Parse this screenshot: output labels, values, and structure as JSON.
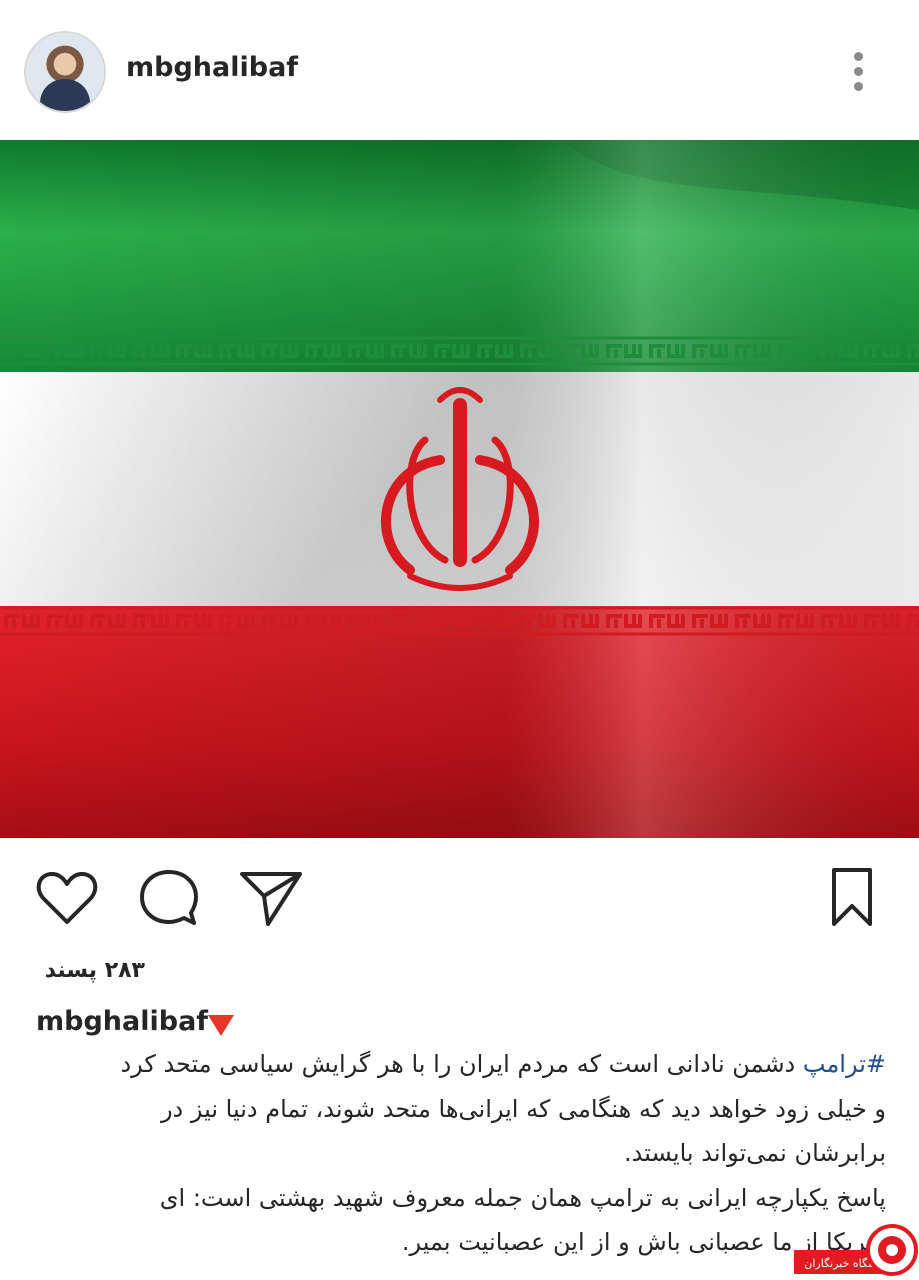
{
  "post": {
    "username": "mbghalibaf",
    "likes_label": "۲۸۳ پسند",
    "caption_username": "mbghalibaf",
    "hashtag": "#ترامپ",
    "caption_lines": [
      " دشمن نادانی است که مردم ایران را با هر گرایش سیاسی متحد کرد",
      "و خیلی زود خواهد دید که هنگامی که ایرانی‌ها متحد شوند، تمام دنیا نیز در",
      "برابرشان نمی‌تواند بایستد.",
      "پاسخ یکپارچه ایرانی به ترامپ همان جمله معروف شهید بهشتی است: ای",
      "آمریکا از ما عصبانی باش و از این عصبانیت بمیر."
    ]
  },
  "icons": {
    "more": "more-options-icon",
    "like": "heart-icon",
    "comment": "comment-icon",
    "share": "send-icon",
    "save": "bookmark-icon",
    "flag_emblem": "emblem-icon",
    "indicator": "red-triangle-icon"
  },
  "colors": {
    "flag_green": "#1f9a3e",
    "flag_white": "#f2f2f2",
    "flag_red": "#d71920",
    "hashtag": "#1f4e8f",
    "text": "#262626"
  },
  "watermark": {
    "text": "باشگاه خبرنگاران"
  }
}
